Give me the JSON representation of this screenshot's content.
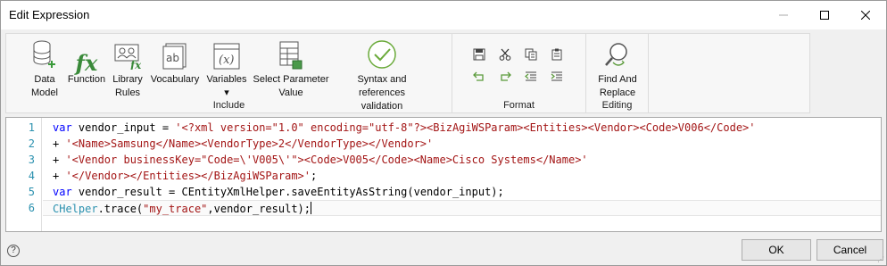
{
  "window": {
    "title": "Edit Expression"
  },
  "ribbon": {
    "include": {
      "label": "Include",
      "buttons": [
        {
          "label": "Data\nModel",
          "icon": "database-add-icon"
        },
        {
          "label": "Function",
          "icon": "function-fx-icon"
        },
        {
          "label": "Library\nRules",
          "icon": "library-rules-icon"
        },
        {
          "label": "Vocabulary",
          "icon": "vocabulary-ab-icon"
        },
        {
          "label": "Variables\n▾",
          "icon": "variables-x-icon"
        },
        {
          "label": "Select Parameter\nValue",
          "icon": "table-parameter-icon"
        },
        {
          "label": "Syntax and references\nvalidation",
          "icon": "check-validation-icon"
        }
      ]
    },
    "format": {
      "label": "Format",
      "buttons": [
        {
          "name": "save",
          "icon": "save-icon"
        },
        {
          "name": "cut",
          "icon": "cut-icon"
        },
        {
          "name": "copy",
          "icon": "copy-icon"
        },
        {
          "name": "paste",
          "icon": "paste-icon"
        },
        {
          "name": "undo",
          "icon": "undo-icon"
        },
        {
          "name": "redo",
          "icon": "redo-icon"
        },
        {
          "name": "outdent",
          "icon": "outdent-icon"
        },
        {
          "name": "indent",
          "icon": "indent-icon"
        }
      ]
    },
    "editing": {
      "label": "Editing",
      "buttons": [
        {
          "label": "Find And\nReplace",
          "icon": "find-replace-icon"
        }
      ]
    }
  },
  "editor": {
    "line_numbers": [
      "1",
      "2",
      "3",
      "4",
      "5",
      "6"
    ],
    "lines": [
      [
        [
          "kw",
          "var"
        ],
        [
          "txt",
          " vendor_input = "
        ],
        [
          "str",
          "'<?xml version=\"1.0\" encoding=\"utf-8\"?><BizAgiWSParam><Entities><Vendor><Code>V006</Code>'"
        ]
      ],
      [
        [
          "txt",
          "+ "
        ],
        [
          "str",
          "'<Name>Samsung</Name><VendorType>2</VendorType></Vendor>'"
        ]
      ],
      [
        [
          "txt",
          "+ "
        ],
        [
          "str",
          "'<Vendor businessKey=\"Code=\\'V005\\'\"><Code>V005</Code><Name>Cisco Systems</Name>'"
        ]
      ],
      [
        [
          "txt",
          "+ "
        ],
        [
          "str",
          "'</Vendor></Entities></BizAgiWSParam>'"
        ],
        [
          "txt",
          ";"
        ]
      ],
      [
        [
          "kw",
          "var"
        ],
        [
          "txt",
          " vendor_result = CEntityXmlHelper.saveEntityAsString(vendor_input);"
        ]
      ],
      [
        [
          "cls",
          "CHelper"
        ],
        [
          "txt",
          ".trace("
        ],
        [
          "str",
          "\"my_trace\""
        ],
        [
          "txt",
          ",vendor_result);"
        ]
      ]
    ]
  },
  "footer": {
    "help": "?",
    "ok_label": "OK",
    "cancel_label": "Cancel"
  }
}
